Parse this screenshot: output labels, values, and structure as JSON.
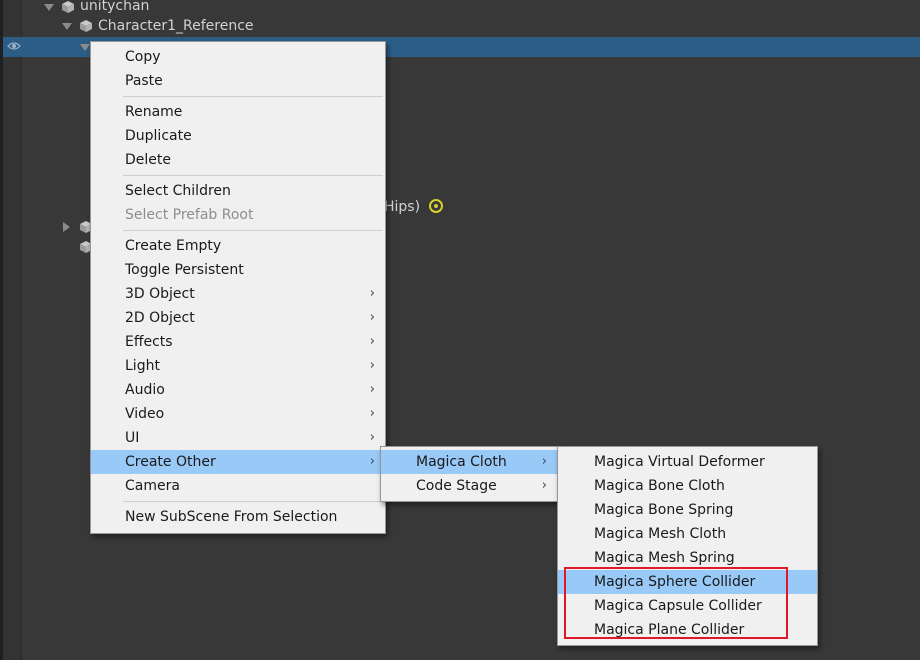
{
  "hierarchy": {
    "items": [
      {
        "label": "unitychan"
      },
      {
        "label": "Character1_Reference"
      },
      {
        "label": "Hips)"
      }
    ]
  },
  "context_menu": {
    "items": [
      {
        "label": "Copy"
      },
      {
        "label": "Paste"
      },
      {
        "label": "Rename"
      },
      {
        "label": "Duplicate"
      },
      {
        "label": "Delete"
      },
      {
        "label": "Select Children"
      },
      {
        "label": "Select Prefab Root",
        "disabled": true
      },
      {
        "label": "Create Empty"
      },
      {
        "label": "Toggle Persistent"
      },
      {
        "label": "3D Object",
        "submenu": true
      },
      {
        "label": "2D Object",
        "submenu": true
      },
      {
        "label": "Effects",
        "submenu": true
      },
      {
        "label": "Light",
        "submenu": true
      },
      {
        "label": "Audio",
        "submenu": true
      },
      {
        "label": "Video",
        "submenu": true
      },
      {
        "label": "UI",
        "submenu": true
      },
      {
        "label": "Create Other",
        "submenu": true,
        "highlighted": true
      },
      {
        "label": "Camera"
      },
      {
        "label": "New SubScene From Selection"
      }
    ]
  },
  "create_other_menu": {
    "items": [
      {
        "label": "Magica Cloth",
        "submenu": true,
        "highlighted": true
      },
      {
        "label": "Code Stage",
        "submenu": true
      }
    ]
  },
  "magica_menu": {
    "items": [
      {
        "label": "Magica Virtual Deformer"
      },
      {
        "label": "Magica Bone Cloth"
      },
      {
        "label": "Magica Bone Spring"
      },
      {
        "label": "Magica Mesh Cloth"
      },
      {
        "label": "Magica Mesh Spring"
      },
      {
        "label": "Magica Sphere Collider",
        "highlighted": true
      },
      {
        "label": "Magica Capsule Collider"
      },
      {
        "label": "Magica Plane Collider"
      }
    ]
  },
  "icons": {
    "submenu_arrow": "›",
    "visibility": "eye-icon",
    "gameobject": "cube-icon",
    "target": "target-icon"
  },
  "colors": {
    "highlight": "#99c9f7",
    "selection_row": "#2c5d87",
    "annotation": "#e0182a"
  }
}
